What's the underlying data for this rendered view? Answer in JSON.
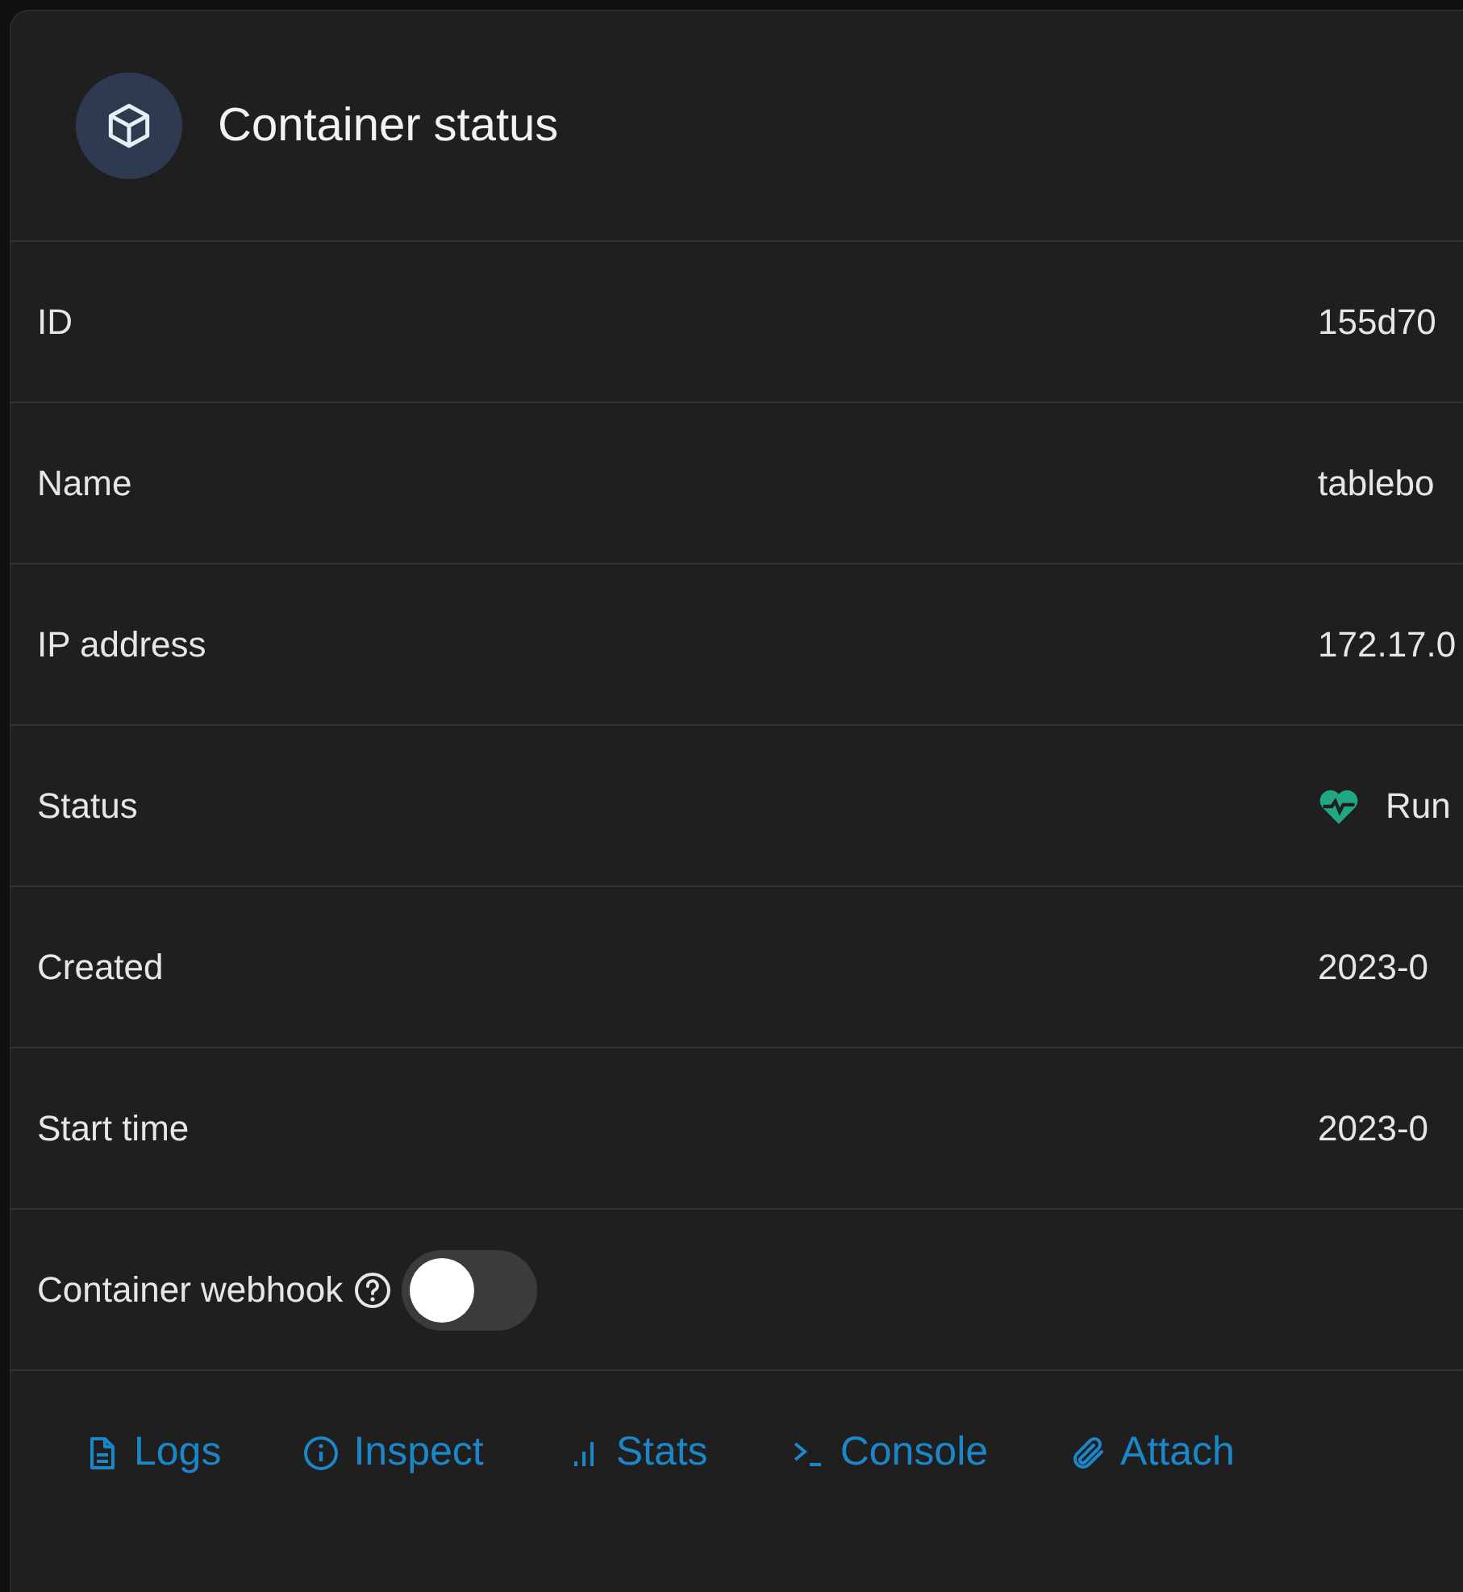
{
  "header": {
    "title": "Container status"
  },
  "rows": [
    {
      "kind": "text",
      "label": "ID",
      "value": "155d70"
    },
    {
      "kind": "text",
      "label": "Name",
      "value": "tablebo"
    },
    {
      "kind": "text",
      "label": "IP address",
      "value": "172.17.0"
    },
    {
      "kind": "status",
      "label": "Status",
      "value": "Run"
    },
    {
      "kind": "text",
      "label": "Created",
      "value": "2023-0"
    },
    {
      "kind": "text",
      "label": "Start time",
      "value": "2023-0"
    }
  ],
  "webhook": {
    "label": "Container webhook",
    "on": false
  },
  "actions": [
    {
      "kind": "logs",
      "label": "Logs"
    },
    {
      "kind": "inspect",
      "label": "Inspect"
    },
    {
      "kind": "stats",
      "label": "Stats"
    },
    {
      "kind": "console",
      "label": "Console"
    },
    {
      "kind": "attach",
      "label": "Attach"
    }
  ]
}
